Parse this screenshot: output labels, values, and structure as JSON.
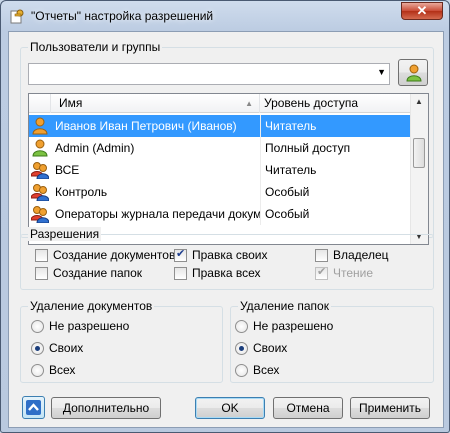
{
  "window": {
    "title": "\"Отчеты\" настройка разрешений",
    "close_label": "✕"
  },
  "users_group": {
    "label": "Пользователи и группы",
    "combo_value": "",
    "columns": {
      "name": "Имя",
      "level": "Уровень доступа"
    },
    "rows": [
      {
        "name": "Иванов Иван Петрович (Иванов)",
        "level": "Читатель",
        "icon": "user-icon",
        "selected": true
      },
      {
        "name": "Admin (Admin)",
        "level": "Полный доступ",
        "icon": "user-icon",
        "selected": false
      },
      {
        "name": "ВСЕ",
        "level": "Читатель",
        "icon": "group-icon",
        "selected": false
      },
      {
        "name": "Контроль",
        "level": "Особый",
        "icon": "group-icon",
        "selected": false
      },
      {
        "name": "Операторы журнала передачи докум...",
        "level": "Особый",
        "icon": "group-icon",
        "selected": false
      }
    ]
  },
  "permissions": {
    "label": "Разрешения",
    "items": [
      {
        "label": "Создание документов",
        "checked": false,
        "disabled": false
      },
      {
        "label": "Правка своих",
        "checked": true,
        "disabled": false
      },
      {
        "label": "Владелец",
        "checked": false,
        "disabled": false
      },
      {
        "label": "Создание папок",
        "checked": false,
        "disabled": false
      },
      {
        "label": "Правка всех",
        "checked": false,
        "disabled": false
      },
      {
        "label": "Чтение",
        "checked": true,
        "disabled": true
      }
    ]
  },
  "delete_documents": {
    "label": "Удаление документов",
    "options": [
      "Не разрешено",
      "Своих",
      "Всех"
    ],
    "selected": "Своих"
  },
  "delete_folders": {
    "label": "Удаление папок",
    "options": [
      "Не разрешено",
      "Своих",
      "Всех"
    ],
    "selected": "Своих"
  },
  "buttons": {
    "advanced": "Дополнительно",
    "ok": "OK",
    "cancel": "Отмена",
    "apply": "Применить"
  },
  "colors": {
    "selection": "#3399ff",
    "user_icon": "#f0a030",
    "accent": "#2f6fc7"
  }
}
